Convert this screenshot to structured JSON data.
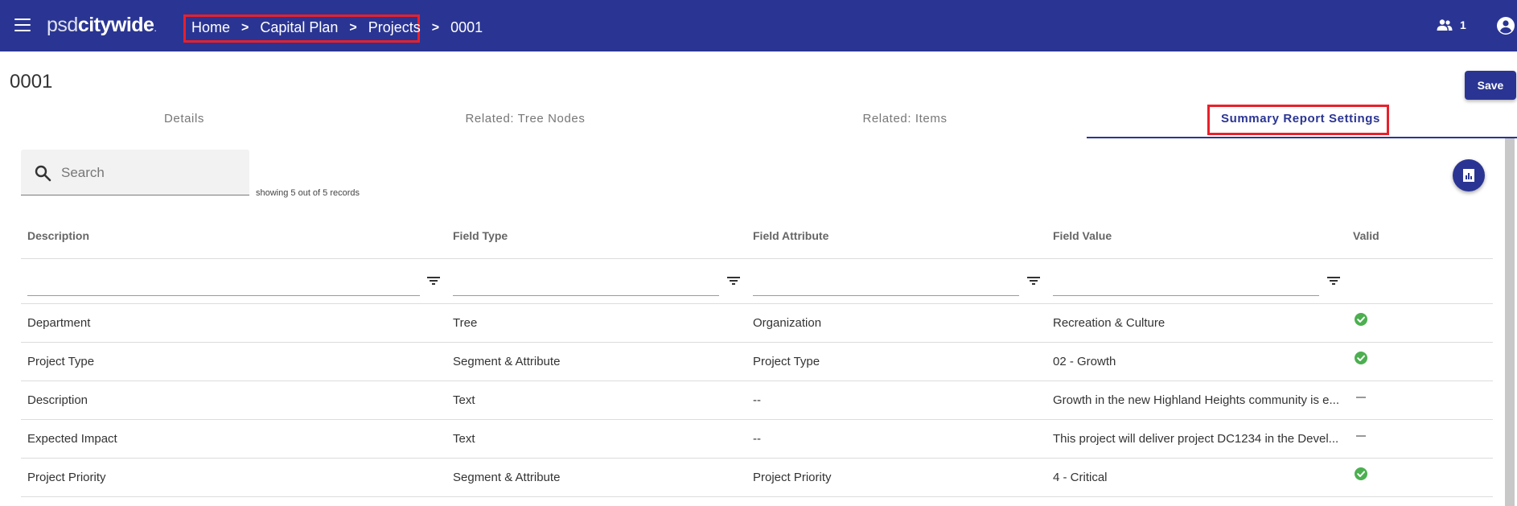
{
  "header": {
    "logo_light": "psd",
    "logo_bold": "citywide",
    "logo_dot": ".",
    "breadcrumbs": [
      "Home",
      "Capital Plan",
      "Projects"
    ],
    "breadcrumb_sep": ">",
    "breadcrumb_current": "0001",
    "users_count": "1"
  },
  "page": {
    "title": "0001",
    "save_label": "Save"
  },
  "tabs": [
    {
      "label": "Details",
      "active": false
    },
    {
      "label": "Related: Tree Nodes",
      "active": false
    },
    {
      "label": "Related: Items",
      "active": false
    },
    {
      "label": "Summary Report Settings",
      "active": true
    }
  ],
  "search": {
    "placeholder": "Search",
    "value": "",
    "records_text": "showing 5 out of 5 records"
  },
  "table": {
    "columns": [
      "Description",
      "Field Type",
      "Field Attribute",
      "Field Value",
      "Valid"
    ],
    "rows": [
      {
        "description": "Department",
        "field_type": "Tree",
        "field_attribute": "Organization",
        "field_value": "Recreation & Culture",
        "valid": "check"
      },
      {
        "description": "Project Type",
        "field_type": "Segment & Attribute",
        "field_attribute": "Project Type",
        "field_value": "02 - Growth",
        "valid": "check"
      },
      {
        "description": "Description",
        "field_type": "Text",
        "field_attribute": "--",
        "field_value": "Growth in the new Highland Heights community is e...",
        "valid": "dash"
      },
      {
        "description": "Expected Impact",
        "field_type": "Text",
        "field_attribute": "--",
        "field_value": "This project will deliver project DC1234 in the Devel...",
        "valid": "dash"
      },
      {
        "description": "Project Priority",
        "field_type": "Segment & Attribute",
        "field_attribute": "Project Priority",
        "field_value": "4 - Critical",
        "valid": "check"
      }
    ]
  },
  "colors": {
    "primary": "#2a3593",
    "highlight_box": "#e8202a",
    "valid_green": "#4caf50"
  }
}
